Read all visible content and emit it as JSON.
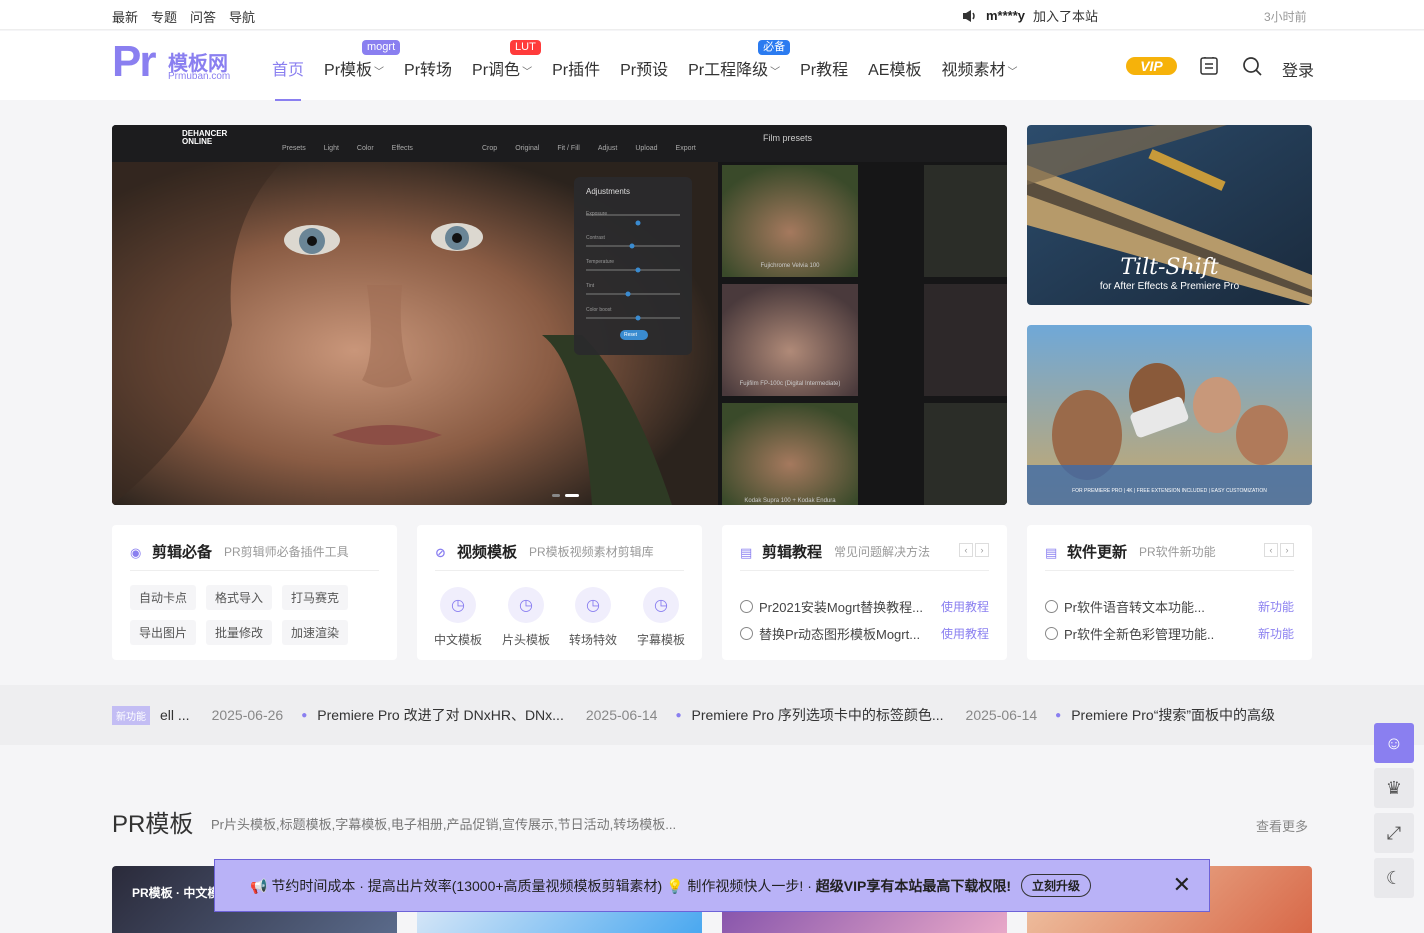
{
  "topbar": {
    "links": [
      "最新",
      "专题",
      "问答",
      "导航"
    ],
    "notice_user": "m****y",
    "notice_text": "加入了本站",
    "notice_time": "3小时前"
  },
  "logo": {
    "main": "Pr",
    "cn": "模板网",
    "en": "Prmuban.com"
  },
  "nav": [
    {
      "label": "首页",
      "active": true
    },
    {
      "label": "Pr模板",
      "badge": "mogrt",
      "badge_color": "#8a7ff0",
      "dropdown": true
    },
    {
      "label": "Pr转场"
    },
    {
      "label": "Pr调色",
      "badge": "LUT",
      "badge_color": "#ff3b3b",
      "dropdown": true
    },
    {
      "label": "Pr插件"
    },
    {
      "label": "Pr预设"
    },
    {
      "label": "Pr工程降级",
      "badge": "必备",
      "badge_color": "#2b7bf0",
      "dropdown": true
    },
    {
      "label": "Pr教程"
    },
    {
      "label": "AE模板"
    },
    {
      "label": "视频素材",
      "dropdown": true
    }
  ],
  "header": {
    "vip": "VIP",
    "login": "登录"
  },
  "banner": {
    "app_name": "DEHANCER\nONLINE",
    "tools": [
      "Presets",
      "Light",
      "Color",
      "Effects",
      "Crop",
      "Original",
      "Fit / Fill",
      "Adjust",
      "Upload",
      "Export"
    ],
    "panel_title": "Adjustments",
    "sliders": [
      "Exposure",
      "Contrast",
      "Temperature",
      "Tint",
      "Color boost"
    ],
    "reset": "Reset",
    "film_title": "Film presets",
    "films": [
      "Fujichrome Velvia 100",
      "Fujifilm FP-100c (Digital Intermediate)",
      "Kodak Supra 100 + Kodak Endura"
    ]
  },
  "side1": {
    "title": "Tilt-Shift",
    "sub": "for After Effects & Premiere Pro"
  },
  "side2": {
    "caption": "FOR PREMIERE PRO | 4K | FREE EXTENSION INCLUDED | EASY CUSTOMIZATION"
  },
  "cards": {
    "c1": {
      "title": "剪辑必备",
      "sub": "PR剪辑师必备插件工具",
      "tags": [
        "自动卡点",
        "格式导入",
        "打马赛克",
        "导出图片",
        "批量修改",
        "加速渲染"
      ]
    },
    "c2": {
      "title": "视频模板",
      "sub": "PR模板视频素材剪辑库",
      "items": [
        "中文模板",
        "片头模板",
        "转场特效",
        "字幕模板"
      ]
    },
    "c3": {
      "title": "剪辑教程",
      "sub": "常见问题解决方法",
      "rows": [
        {
          "t": "Pr2021安装Mogrt替换教程...",
          "k": "使用教程"
        },
        {
          "t": "替换Pr动态图形模板Mogrt...",
          "k": "使用教程"
        }
      ]
    },
    "c4": {
      "title": "软件更新",
      "sub": "PR软件新功能",
      "rows": [
        {
          "t": "Pr软件语音转文本功能...",
          "k": "新功能"
        },
        {
          "t": "Pr软件全新色彩管理功能..",
          "k": "新功能"
        }
      ]
    }
  },
  "ticker": {
    "badge": "新功能",
    "items": [
      {
        "t": "ell ...",
        "d": "2025-06-26"
      },
      {
        "t": "Premiere Pro 改进了对 DNxHR、DNx...",
        "d": "2025-06-14"
      },
      {
        "t": "Premiere Pro 序列选项卡中的标签颜色...",
        "d": "2025-06-14"
      },
      {
        "t": "Premiere Pro“搜索”面板中的高级",
        "d": ""
      }
    ]
  },
  "section": {
    "title": "PR模板",
    "sub": "Pr片头模板,标题模板,字幕模板,电子相册,产品促销,宣传展示,节日活动,转场模板...",
    "more": "查看更多",
    "thumb1_label": "PR模板 · 中文模"
  },
  "promo": {
    "text1": "节约时间成本 · 提高出片效率(13000+高质量视频模板剪辑素材)",
    "text2": "制作视频快人一步! · ",
    "text3": "超级VIP享有本站最高下载权限!",
    "button": "立刻升级"
  },
  "colors": {
    "accent": "#8a7ff0",
    "vip": "#f6b20a"
  }
}
